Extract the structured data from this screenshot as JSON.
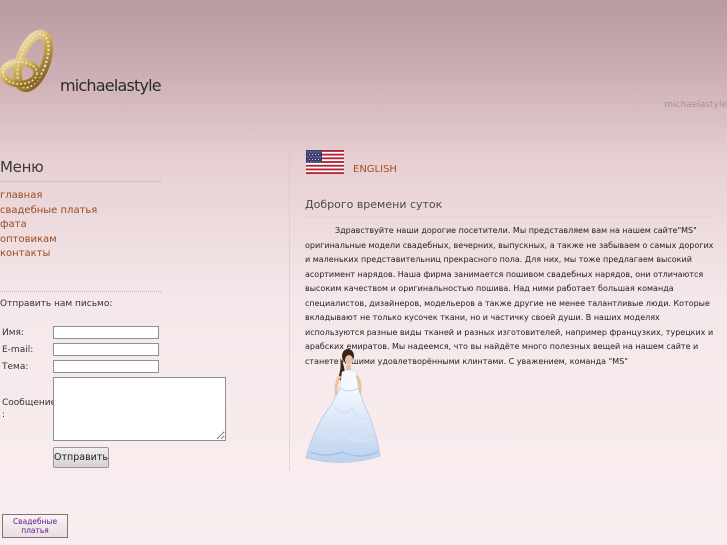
{
  "header": {
    "site_name": "michaelastyle",
    "site_name_small": "michaelastyle"
  },
  "sidebar": {
    "menu_title": "Меню",
    "menu_items": [
      {
        "label": "главная"
      },
      {
        "label": "свадебные платья"
      },
      {
        "label": "фата"
      },
      {
        "label": "оптовикам"
      },
      {
        "label": "контакты"
      }
    ],
    "mail_label": "Отправить нам письмо:",
    "form": {
      "name_label": "Имя:",
      "email_label": "E-mail:",
      "subject_label": "Тема:",
      "message_label": "Сообщение",
      "message_label_colon": ":",
      "submit_label": "Отправить"
    }
  },
  "main": {
    "language_link": "ENGLISH",
    "greeting_title": "Доброго времени суток",
    "body_text": "Здравствуйте наши дорогие посетители. Мы представляем вам на нашем сайте\"MS\" оригинальные модели свадебных, вечерних, выпускных, а также не забываем о самых дорогих и маленьких представительниц прекрасного пола. Для них, мы тоже предлагаем высокий асортимент нарядов. Наша фирма занимается пошивом свадебных нарядов, они отличаются высоким качеством и оригинальностью пошива. Над ними работает большая команда специалистов, дизайнеров, модельеров а также другие не менее талантливые люди. Которые вкладывают не только кусочек ткани, но и частичку своей души. В наших моделях используются разные виды тканей и разных изготовителей, например французких, турецких и арабских емиратов. Мы надеемся, что вы найдёте много полезных вещей на нашем сайте и станете нашими удовлетворёнными клинтами. С уважением, команда \"MS\""
  },
  "footer": {
    "banner_label": "Свадебные платья"
  },
  "icons": {
    "logo": "wedding-rings-icon",
    "flag": "us-flag-icon",
    "dress": "wedding-dress-image"
  }
}
